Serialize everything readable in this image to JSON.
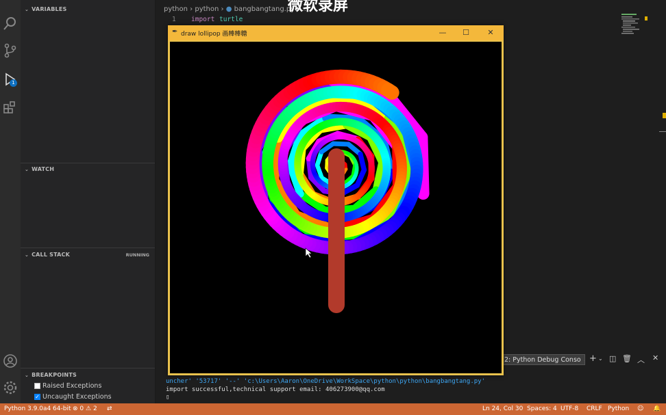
{
  "sidebar": {
    "variables_title": "VARIABLES",
    "watch_title": "WATCH",
    "callstack_title": "CALL STACK",
    "callstack_status": "RUNNING",
    "breakpoints_title": "BREAKPOINTS",
    "breakpoints": [
      {
        "label": "Raised Exceptions",
        "checked": false
      },
      {
        "label": "Uncaught Exceptions",
        "checked": true
      }
    ],
    "debug_badge": "1"
  },
  "editor": {
    "breadcrumb": [
      "python",
      "python",
      "bangbangtang.py",
      "..."
    ],
    "line_number": "1",
    "code_keyword": "import",
    "code_module": "turtle"
  },
  "turtle_window": {
    "title": "draw lollipop 画棒棒糖",
    "minimize": "—",
    "maximize": "☐",
    "close": "✕",
    "colors": {
      "background": "#000000",
      "stick": "#b23a2b",
      "spiral": [
        "#ff0000",
        "#ff7f00",
        "#ffff00",
        "#7fff00",
        "#00ff00",
        "#00ffff",
        "#0080ff",
        "#0000ff",
        "#8000ff",
        "#ff00ff"
      ]
    }
  },
  "terminal": {
    "dropdown": "2: Python Debug Conso",
    "line1": "uncher' '53717' '--' 'c:\\Users\\Aaron\\OneDrive\\WorkSpace\\python\\python\\bangbangtang.py'",
    "line2": "import successful,technical support email: 406273900@qq.com",
    "line3": "▯"
  },
  "status_bar": {
    "interpreter": "Python 3.9.0a4 64-bit",
    "errors": "0",
    "warnings": "2",
    "position": "Ln 24, Col 30",
    "spaces": "Spaces: 4",
    "encoding": "UTF-8",
    "eol": "CRLF",
    "language": "Python"
  },
  "watermark": "微软录屏"
}
